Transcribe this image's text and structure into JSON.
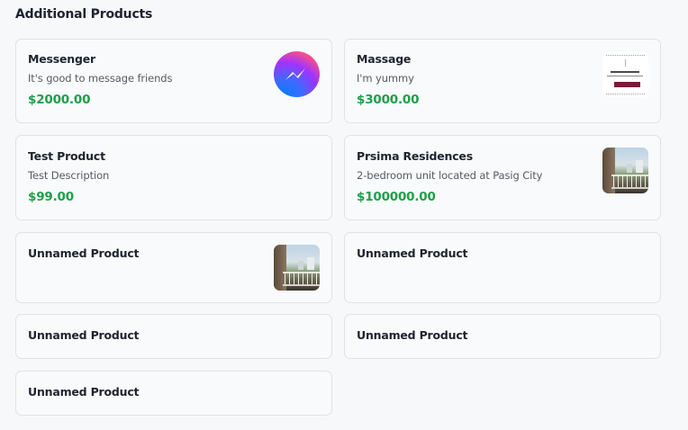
{
  "section": {
    "title": "Additional Products"
  },
  "products": [
    {
      "name": "Messenger",
      "description": "It's good to message friends",
      "price": "$2000.00",
      "thumbnail": "messenger-logo"
    },
    {
      "name": "Massage",
      "description": "I'm yummy",
      "price": "$3000.00",
      "thumbnail": "massage-flyer"
    },
    {
      "name": "Test Product",
      "description": "Test Description",
      "price": "$99.00"
    },
    {
      "name": "Prsima Residences",
      "description": "2-bedroom unit located at Pasig City",
      "price": "$100000.00",
      "thumbnail": "balcony-photo"
    },
    {
      "name": "Unnamed Product",
      "thumbnail": "balcony-photo"
    },
    {
      "name": "Unnamed Product"
    },
    {
      "name": "Unnamed Product"
    },
    {
      "name": "Unnamed Product"
    },
    {
      "name": "Unnamed Product"
    }
  ],
  "colors": {
    "price": "#1e9f4a",
    "card_border": "#dfe2e7",
    "background": "#f7f8fa"
  }
}
